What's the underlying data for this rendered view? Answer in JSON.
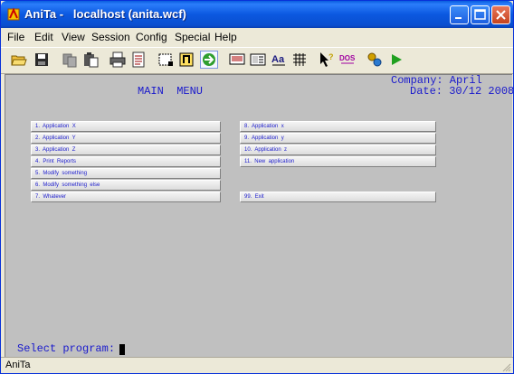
{
  "window": {
    "title": "AniTa -   localhost (anita.wcf)"
  },
  "menu": [
    "File",
    "Edit",
    "View",
    "Session",
    "Config",
    "Special",
    "Help"
  ],
  "toolbar_icons": [
    "open-folder-icon",
    "save-icon",
    "copy-icon",
    "paste-icon",
    "print-icon",
    "print-preview-icon",
    "select-icon",
    "paste-special-icon",
    "connect-icon",
    "screen-icon",
    "form-icon",
    "font-icon",
    "grid-icon",
    "help-pointer-icon",
    "dos-icon",
    "settings-icon",
    "play-icon"
  ],
  "terminal": {
    "company_line": "Company: April",
    "date_line": "Date: 30/12 2008",
    "menu_title": "MAIN  MENU",
    "left_items": [
      "1.  Application  X",
      "2.  Application  Y",
      "3.  Application  Z",
      "4.  Print  Reports",
      "5.  Modify  something",
      "6.  Modify  something  else",
      "7.  Whatever"
    ],
    "right_items": [
      "8.  Application  x",
      "9.  Application  y",
      "10.  Application  z",
      "11.  New  application"
    ],
    "exit_item": "99.  Exit",
    "prompt": "Select program: "
  },
  "status": {
    "text": "AniTa"
  },
  "colors": {
    "terminal_bg": "#c0c0c0",
    "terminal_text": "#1a1acc",
    "title_bar": "#0a5ddf"
  }
}
